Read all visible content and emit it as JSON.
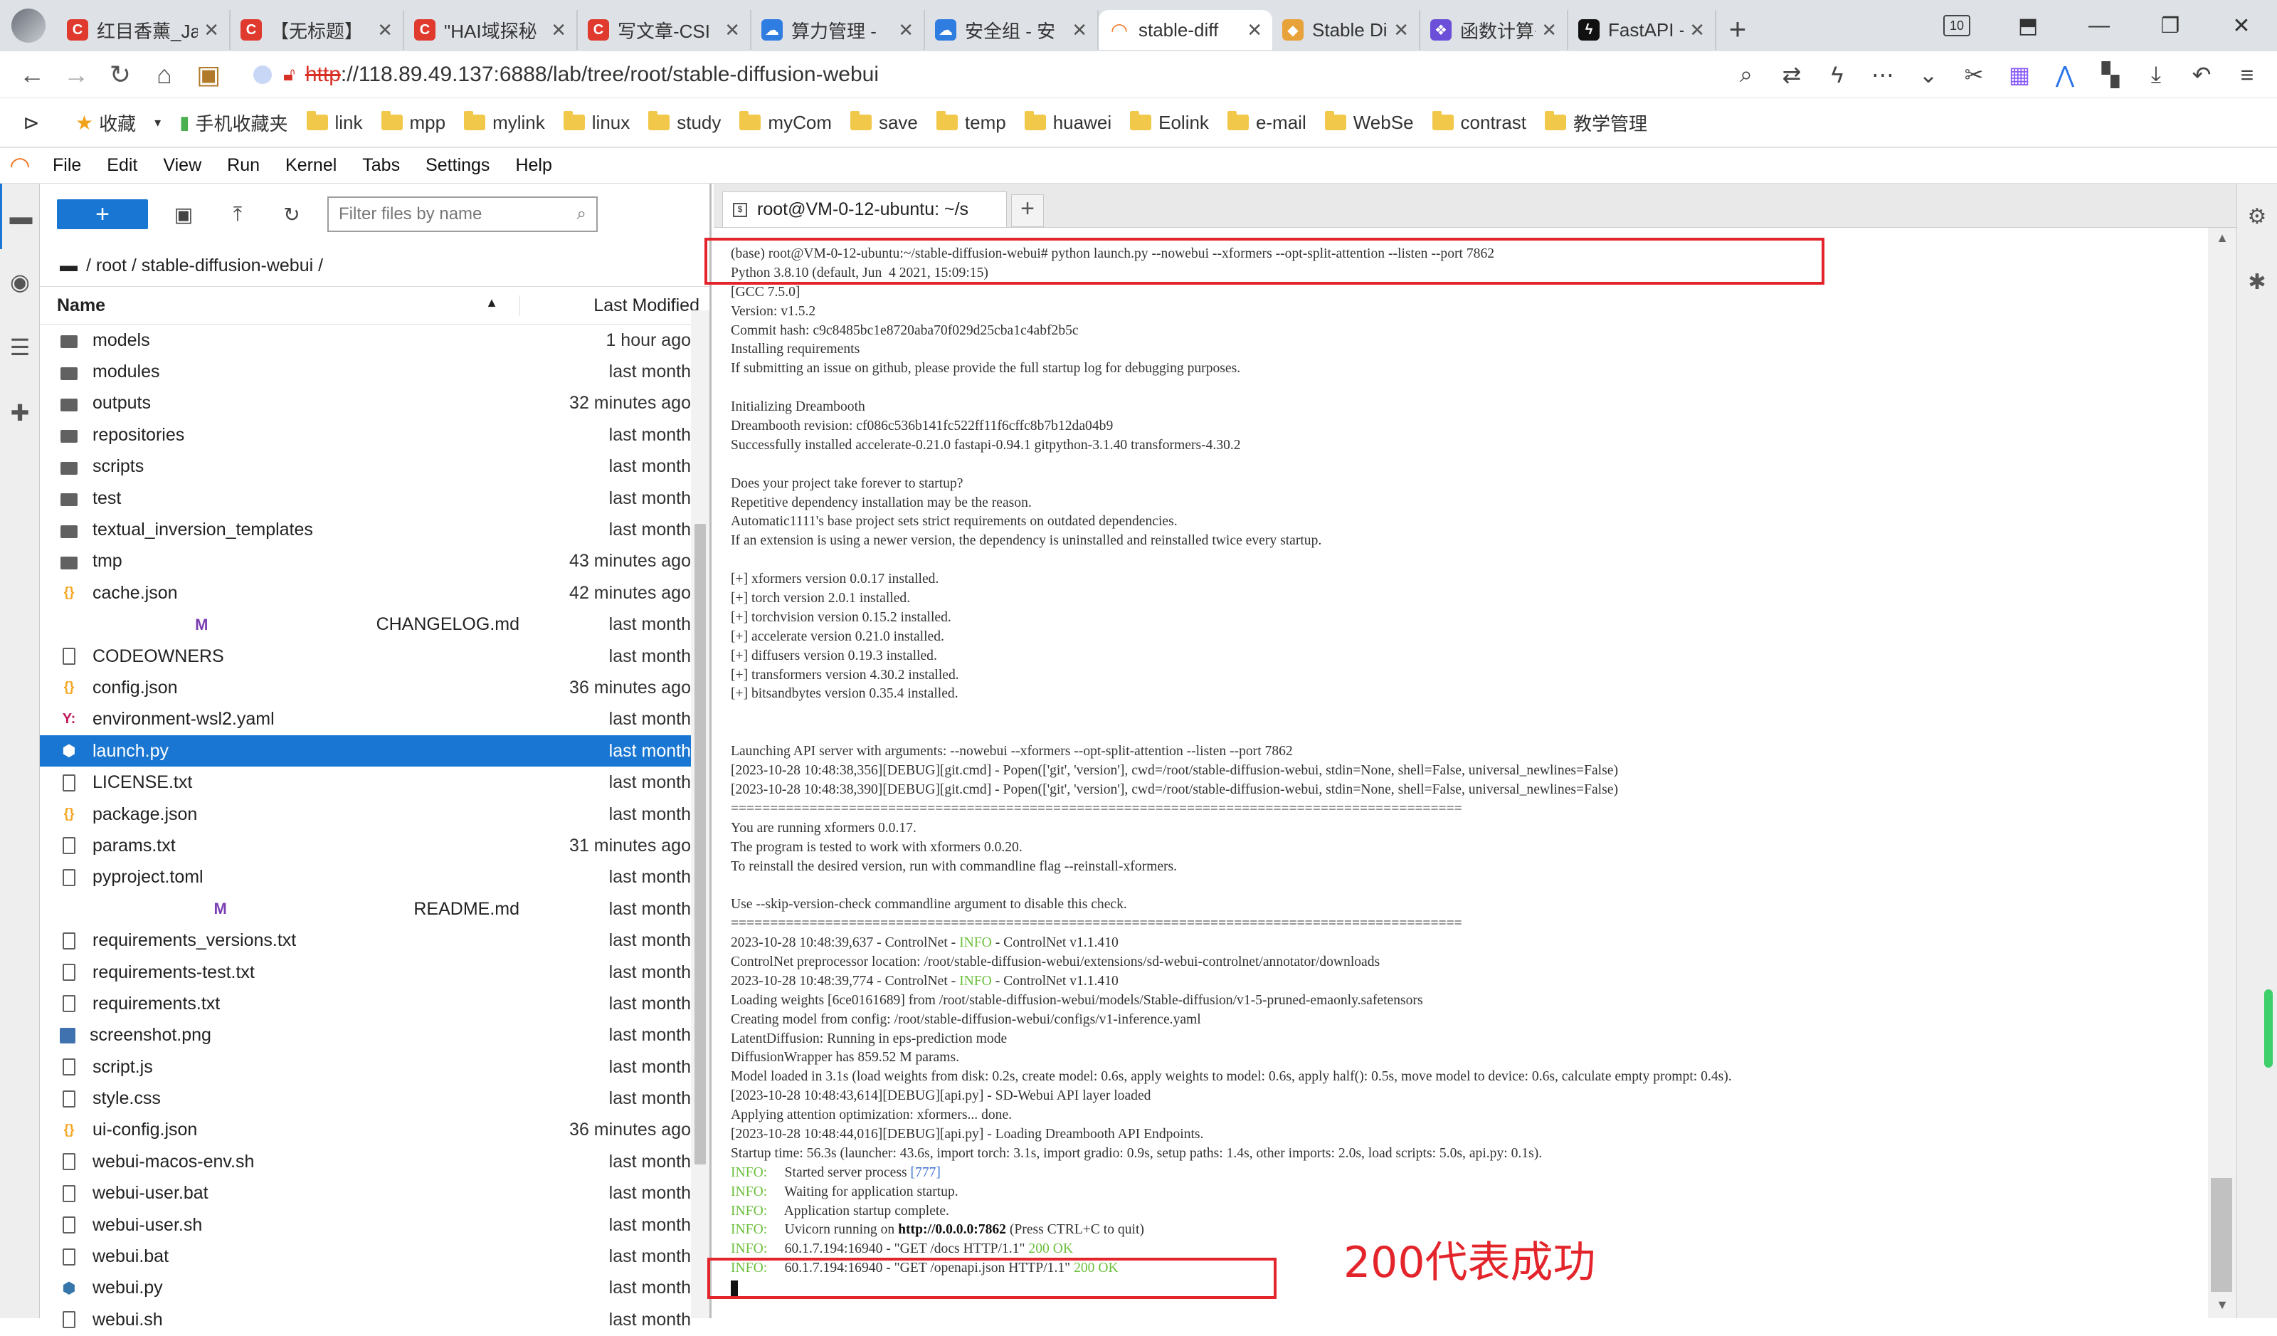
{
  "browser": {
    "tab_count": "10",
    "tabs": [
      {
        "title": "红目香薰_Ja",
        "color": "#e03a2f",
        "glyph": "C"
      },
      {
        "title": "【无标题】",
        "color": "#e03a2f",
        "glyph": "C"
      },
      {
        "title": "\"HAI域探秘",
        "color": "#e03a2f",
        "glyph": "C"
      },
      {
        "title": "写文章-CSI",
        "color": "#e03a2f",
        "glyph": "C"
      },
      {
        "title": "算力管理 -",
        "color": "#2f7de1",
        "glyph": "☁"
      },
      {
        "title": "安全组 - 安",
        "color": "#2f7de1",
        "glyph": "☁"
      },
      {
        "title": "stable-diff",
        "color": "#f37726",
        "glyph": "◠"
      },
      {
        "title": "Stable Diff",
        "color": "#e8a23a",
        "glyph": "◆"
      },
      {
        "title": "函数计算+ J",
        "color": "#6b4fd8",
        "glyph": "❖"
      },
      {
        "title": "FastAPI - S",
        "color": "#111111",
        "glyph": "ϟ"
      }
    ],
    "url_protocol": "http",
    "url_rest": "://118.89.49.137:6888/lab/tree/root/stable-diffusion-webui",
    "bookmarks": [
      {
        "label": "收藏",
        "kind": "star"
      },
      {
        "label": "手机收藏夹",
        "kind": "phone"
      },
      {
        "label": "link",
        "kind": "folder"
      },
      {
        "label": "mpp",
        "kind": "folder"
      },
      {
        "label": "mylink",
        "kind": "folder"
      },
      {
        "label": "linux",
        "kind": "folder"
      },
      {
        "label": "study",
        "kind": "folder"
      },
      {
        "label": "myCom",
        "kind": "folder"
      },
      {
        "label": "save",
        "kind": "folder"
      },
      {
        "label": "temp",
        "kind": "folder"
      },
      {
        "label": "huawei",
        "kind": "folder"
      },
      {
        "label": "Eolink",
        "kind": "folder"
      },
      {
        "label": "e-mail",
        "kind": "folder"
      },
      {
        "label": "WebSe",
        "kind": "folder"
      },
      {
        "label": "contrast",
        "kind": "folder"
      },
      {
        "label": "教学管理",
        "kind": "folder"
      }
    ]
  },
  "jupyter": {
    "menu": [
      "File",
      "Edit",
      "View",
      "Run",
      "Kernel",
      "Tabs",
      "Settings",
      "Help"
    ],
    "new_button": "+",
    "filter_placeholder": "Filter files by name",
    "breadcrumb": "/ root / stable-diffusion-webui /",
    "col_name": "Name",
    "col_modified": "Last Modified",
    "files": [
      {
        "name": "models",
        "modified": "1 hour ago",
        "type": "folder"
      },
      {
        "name": "modules",
        "modified": "last month",
        "type": "folder"
      },
      {
        "name": "outputs",
        "modified": "32 minutes ago",
        "type": "folder"
      },
      {
        "name": "repositories",
        "modified": "last month",
        "type": "folder"
      },
      {
        "name": "scripts",
        "modified": "last month",
        "type": "folder"
      },
      {
        "name": "test",
        "modified": "last month",
        "type": "folder"
      },
      {
        "name": "textual_inversion_templates",
        "modified": "last month",
        "type": "folder"
      },
      {
        "name": "tmp",
        "modified": "43 minutes ago",
        "type": "folder"
      },
      {
        "name": "cache.json",
        "modified": "42 minutes ago",
        "type": "json"
      },
      {
        "name": "CHANGELOG.md",
        "modified": "last month",
        "type": "md"
      },
      {
        "name": "CODEOWNERS",
        "modified": "last month",
        "type": "doc"
      },
      {
        "name": "config.json",
        "modified": "36 minutes ago",
        "type": "json"
      },
      {
        "name": "environment-wsl2.yaml",
        "modified": "last month",
        "type": "yaml"
      },
      {
        "name": "launch.py",
        "modified": "last month",
        "type": "py",
        "selected": true
      },
      {
        "name": "LICENSE.txt",
        "modified": "last month",
        "type": "doc"
      },
      {
        "name": "package.json",
        "modified": "last month",
        "type": "json"
      },
      {
        "name": "params.txt",
        "modified": "31 minutes ago",
        "type": "doc"
      },
      {
        "name": "pyproject.toml",
        "modified": "last month",
        "type": "doc"
      },
      {
        "name": "README.md",
        "modified": "last month",
        "type": "md"
      },
      {
        "name": "requirements_versions.txt",
        "modified": "last month",
        "type": "doc"
      },
      {
        "name": "requirements-test.txt",
        "modified": "last month",
        "type": "doc"
      },
      {
        "name": "requirements.txt",
        "modified": "last month",
        "type": "doc"
      },
      {
        "name": "screenshot.png",
        "modified": "last month",
        "type": "png"
      },
      {
        "name": "script.js",
        "modified": "last month",
        "type": "doc"
      },
      {
        "name": "style.css",
        "modified": "last month",
        "type": "doc"
      },
      {
        "name": "ui-config.json",
        "modified": "36 minutes ago",
        "type": "json"
      },
      {
        "name": "webui-macos-env.sh",
        "modified": "last month",
        "type": "doc"
      },
      {
        "name": "webui-user.bat",
        "modified": "last month",
        "type": "doc"
      },
      {
        "name": "webui-user.sh",
        "modified": "last month",
        "type": "doc"
      },
      {
        "name": "webui.bat",
        "modified": "last month",
        "type": "doc"
      },
      {
        "name": "webui.py",
        "modified": "last month",
        "type": "py"
      },
      {
        "name": "webui.sh",
        "modified": "last month",
        "type": "doc"
      }
    ],
    "terminal_tab": "root@VM-0-12-ubuntu: ~/s",
    "terminal_lines": [
      "(base) root@VM-0-12-ubuntu:~/stable-diffusion-webui# python launch.py --nowebui --xformers --opt-split-attention --listen --port 7862",
      "Python 3.8.10 (default, Jun  4 2021, 15:09:15)",
      "[GCC 7.5.0]",
      "Version: v1.5.2",
      "Commit hash: c9c8485bc1e8720aba70f029d25cba1c4abf2b5c",
      "Installing requirements",
      "If submitting an issue on github, please provide the full startup log for debugging purposes.",
      "",
      "Initializing Dreambooth",
      "Dreambooth revision: cf086c536b141fc522ff11f6cffc8b7b12da04b9",
      "Successfully installed accelerate-0.21.0 fastapi-0.94.1 gitpython-3.1.40 transformers-4.30.2",
      "",
      "Does your project take forever to startup?",
      "Repetitive dependency installation may be the reason.",
      "Automatic1111's base project sets strict requirements on outdated dependencies.",
      "If an extension is using a newer version, the dependency is uninstalled and reinstalled twice every startup.",
      "",
      "[+] xformers version 0.0.17 installed.",
      "[+] torch version 2.0.1 installed.",
      "[+] torchvision version 0.15.2 installed.",
      "[+] accelerate version 0.21.0 installed.",
      "[+] diffusers version 0.19.3 installed.",
      "[+] transformers version 4.30.2 installed.",
      "[+] bitsandbytes version 0.35.4 installed.",
      "",
      "",
      "Launching API server with arguments: --nowebui --xformers --opt-split-attention --listen --port 7862",
      "[2023-10-28 10:48:38,356][DEBUG][git.cmd] - Popen(['git', 'version'], cwd=/root/stable-diffusion-webui, stdin=None, shell=False, universal_newlines=False)",
      "[2023-10-28 10:48:38,390][DEBUG][git.cmd] - Popen(['git', 'version'], cwd=/root/stable-diffusion-webui, stdin=None, shell=False, universal_newlines=False)",
      "=============================================================================================",
      "You are running xformers 0.0.17.",
      "The program is tested to work with xformers 0.0.20.",
      "To reinstall the desired version, run with commandline flag --reinstall-xformers.",
      "",
      "Use --skip-version-check commandline argument to disable this check.",
      "=============================================================================================",
      "2023-10-28 10:48:39,637 - ControlNet - INFO - ControlNet v1.1.410",
      "ControlNet preprocessor location: /root/stable-diffusion-webui/extensions/sd-webui-controlnet/annotator/downloads",
      "2023-10-28 10:48:39,774 - ControlNet - INFO - ControlNet v1.1.410",
      "Loading weights [6ce0161689] from /root/stable-diffusion-webui/models/Stable-diffusion/v1-5-pruned-emaonly.safetensors",
      "Creating model from config: /root/stable-diffusion-webui/configs/v1-inference.yaml",
      "LatentDiffusion: Running in eps-prediction mode",
      "DiffusionWrapper has 859.52 M params.",
      "Model loaded in 3.1s (load weights from disk: 0.2s, create model: 0.6s, apply weights to model: 0.6s, apply half(): 0.5s, move model to device: 0.6s, calculate empty prompt: 0.4s).",
      "[2023-10-28 10:48:43,614][DEBUG][api.py] - SD-Webui API layer loaded",
      "Applying attention optimization: xformers... done.",
      "[2023-10-28 10:48:44,016][DEBUG][api.py] - Loading Dreambooth API Endpoints.",
      "Startup time: 56.3s (launcher: 43.6s, import torch: 3.1s, import gradio: 0.9s, setup paths: 1.4s, other imports: 2.0s, load scripts: 5.0s, api.py: 0.1s).",
      "INFO:     Started server process [777]",
      "INFO:     Waiting for application startup.",
      "INFO:     Application startup complete.",
      "INFO:     Uvicorn running on http://0.0.0.0:7862 (Press CTRL+C to quit)",
      "INFO:     60.1.7.194:16940 - \"GET /docs HTTP/1.1\" 200 OK",
      "INFO:     60.1.7.194:16940 - \"GET /openapi.json HTTP/1.1\" 200 OK"
    ],
    "annotation": "200代表成功"
  },
  "colors": {
    "accent": "#1976d2",
    "annotation": "#e3252b",
    "info_green": "#6cbf3c"
  }
}
